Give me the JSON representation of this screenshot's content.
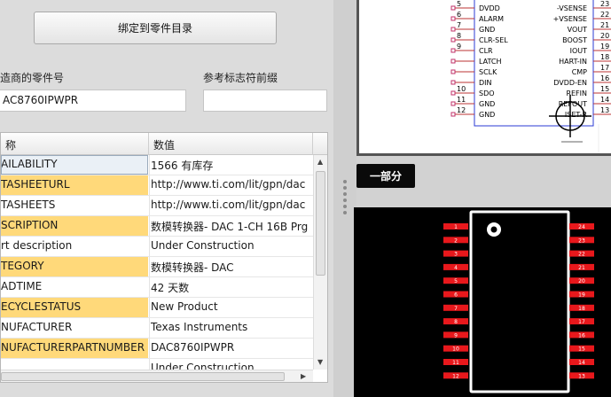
{
  "bind_button_label": "绑定到零件目录",
  "supplier_pn": {
    "label": "造商的零件号",
    "value": "AC8760IPWPR"
  },
  "ref_prefix": {
    "label": "参考标志符前缀",
    "value": ""
  },
  "grid": {
    "headers": [
      "称",
      "数值"
    ],
    "rows": [
      {
        "name": "AILABILITY",
        "value": "1566 有库存"
      },
      {
        "name": "TASHEETURL",
        "value": "http://www.ti.com/lit/gpn/dac"
      },
      {
        "name": "TASHEETS",
        "value": "http://www.ti.com/lit/gpn/dac"
      },
      {
        "name": "SCRIPTION",
        "value": "数模转换器- DAC 1-CH 16B Prg"
      },
      {
        "name": "rt description",
        "value": "Under Construction"
      },
      {
        "name": "TEGORY",
        "value": "数模转换器- DAC"
      },
      {
        "name": "ADTIME",
        "value": "42 天数"
      },
      {
        "name": "ECYCLESTATUS",
        "value": "New Product"
      },
      {
        "name": "NUFACTURER",
        "value": "Texas Instruments"
      },
      {
        "name": "NUFACTURERPARTNUMBER",
        "value": "DAC8760IPWPR"
      },
      {
        "name": "",
        "value": "Under Construction"
      }
    ]
  },
  "schematic": {
    "left_pins": [
      {
        "num": "5",
        "name": "DVDD"
      },
      {
        "num": "6",
        "name": "ALARM"
      },
      {
        "num": "7",
        "name": "GND"
      },
      {
        "num": "8",
        "name": "CLR-SEL"
      },
      {
        "num": "9",
        "name": "CLR"
      },
      {
        "num": "",
        "name": "LATCH"
      },
      {
        "num": "",
        "name": "SCLK"
      },
      {
        "num": "",
        "name": "DIN"
      },
      {
        "num": "10",
        "name": "SDO"
      },
      {
        "num": "11",
        "name": "GND"
      },
      {
        "num": "12",
        "name": "GND"
      }
    ],
    "right_pins": [
      {
        "num": "23",
        "name": "-VSENSE"
      },
      {
        "num": "22",
        "name": "+VSENSE"
      },
      {
        "num": "21",
        "name": "VOUT"
      },
      {
        "num": "20",
        "name": "BOOST"
      },
      {
        "num": "19",
        "name": "IOUT"
      },
      {
        "num": "18",
        "name": "HART-IN"
      },
      {
        "num": "17",
        "name": "CMP"
      },
      {
        "num": "16",
        "name": "DVDD-EN"
      },
      {
        "num": "15",
        "name": "REFIN"
      },
      {
        "num": "14",
        "name": "REFOUT"
      },
      {
        "num": "13",
        "name": "ISET-R"
      }
    ]
  },
  "tab_label": "一部分",
  "pcb": {
    "left_pads": [
      "1",
      "2",
      "3",
      "4",
      "5",
      "6",
      "7",
      "8",
      "9",
      "10",
      "11",
      "12"
    ],
    "right_pads": [
      "24",
      "23",
      "22",
      "21",
      "20",
      "19",
      "18",
      "17",
      "16",
      "15",
      "14",
      "13"
    ]
  }
}
